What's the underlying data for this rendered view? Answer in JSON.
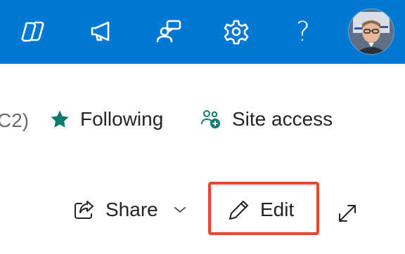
{
  "header": {
    "icons": [
      "copilot-icon",
      "megaphone-icon",
      "chat-feedback-icon",
      "gear-icon",
      "help-icon"
    ],
    "help_glyph": "?",
    "brand_color": "#0078d4"
  },
  "commands": {
    "truncated_text": "C2)",
    "following_label": "Following",
    "site_access_label": "Site access",
    "share_label": "Share",
    "edit_label": "Edit"
  },
  "colors": {
    "accent_teal": "#0f7b6c",
    "highlight_red": "#e8472f"
  }
}
